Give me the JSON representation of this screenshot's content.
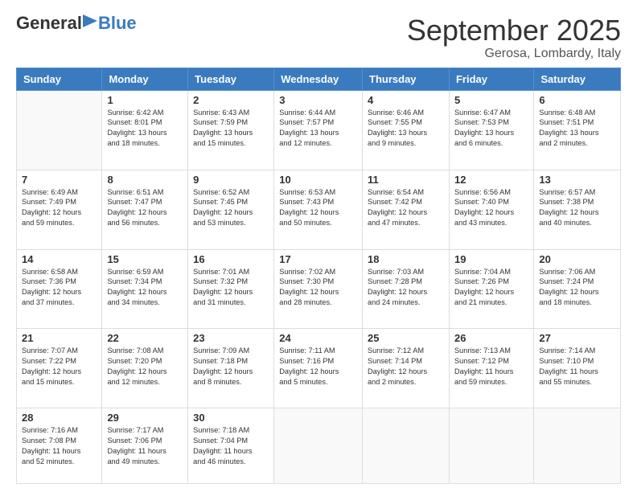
{
  "logo": {
    "general": "General",
    "blue": "Blue"
  },
  "header": {
    "month": "September 2025",
    "location": "Gerosa, Lombardy, Italy"
  },
  "weekdays": [
    "Sunday",
    "Monday",
    "Tuesday",
    "Wednesday",
    "Thursday",
    "Friday",
    "Saturday"
  ],
  "weeks": [
    [
      {
        "day": "",
        "info": ""
      },
      {
        "day": "1",
        "info": "Sunrise: 6:42 AM\nSunset: 8:01 PM\nDaylight: 13 hours\nand 18 minutes."
      },
      {
        "day": "2",
        "info": "Sunrise: 6:43 AM\nSunset: 7:59 PM\nDaylight: 13 hours\nand 15 minutes."
      },
      {
        "day": "3",
        "info": "Sunrise: 6:44 AM\nSunset: 7:57 PM\nDaylight: 13 hours\nand 12 minutes."
      },
      {
        "day": "4",
        "info": "Sunrise: 6:46 AM\nSunset: 7:55 PM\nDaylight: 13 hours\nand 9 minutes."
      },
      {
        "day": "5",
        "info": "Sunrise: 6:47 AM\nSunset: 7:53 PM\nDaylight: 13 hours\nand 6 minutes."
      },
      {
        "day": "6",
        "info": "Sunrise: 6:48 AM\nSunset: 7:51 PM\nDaylight: 13 hours\nand 2 minutes."
      }
    ],
    [
      {
        "day": "7",
        "info": "Sunrise: 6:49 AM\nSunset: 7:49 PM\nDaylight: 12 hours\nand 59 minutes."
      },
      {
        "day": "8",
        "info": "Sunrise: 6:51 AM\nSunset: 7:47 PM\nDaylight: 12 hours\nand 56 minutes."
      },
      {
        "day": "9",
        "info": "Sunrise: 6:52 AM\nSunset: 7:45 PM\nDaylight: 12 hours\nand 53 minutes."
      },
      {
        "day": "10",
        "info": "Sunrise: 6:53 AM\nSunset: 7:43 PM\nDaylight: 12 hours\nand 50 minutes."
      },
      {
        "day": "11",
        "info": "Sunrise: 6:54 AM\nSunset: 7:42 PM\nDaylight: 12 hours\nand 47 minutes."
      },
      {
        "day": "12",
        "info": "Sunrise: 6:56 AM\nSunset: 7:40 PM\nDaylight: 12 hours\nand 43 minutes."
      },
      {
        "day": "13",
        "info": "Sunrise: 6:57 AM\nSunset: 7:38 PM\nDaylight: 12 hours\nand 40 minutes."
      }
    ],
    [
      {
        "day": "14",
        "info": "Sunrise: 6:58 AM\nSunset: 7:36 PM\nDaylight: 12 hours\nand 37 minutes."
      },
      {
        "day": "15",
        "info": "Sunrise: 6:59 AM\nSunset: 7:34 PM\nDaylight: 12 hours\nand 34 minutes."
      },
      {
        "day": "16",
        "info": "Sunrise: 7:01 AM\nSunset: 7:32 PM\nDaylight: 12 hours\nand 31 minutes."
      },
      {
        "day": "17",
        "info": "Sunrise: 7:02 AM\nSunset: 7:30 PM\nDaylight: 12 hours\nand 28 minutes."
      },
      {
        "day": "18",
        "info": "Sunrise: 7:03 AM\nSunset: 7:28 PM\nDaylight: 12 hours\nand 24 minutes."
      },
      {
        "day": "19",
        "info": "Sunrise: 7:04 AM\nSunset: 7:26 PM\nDaylight: 12 hours\nand 21 minutes."
      },
      {
        "day": "20",
        "info": "Sunrise: 7:06 AM\nSunset: 7:24 PM\nDaylight: 12 hours\nand 18 minutes."
      }
    ],
    [
      {
        "day": "21",
        "info": "Sunrise: 7:07 AM\nSunset: 7:22 PM\nDaylight: 12 hours\nand 15 minutes."
      },
      {
        "day": "22",
        "info": "Sunrise: 7:08 AM\nSunset: 7:20 PM\nDaylight: 12 hours\nand 12 minutes."
      },
      {
        "day": "23",
        "info": "Sunrise: 7:09 AM\nSunset: 7:18 PM\nDaylight: 12 hours\nand 8 minutes."
      },
      {
        "day": "24",
        "info": "Sunrise: 7:11 AM\nSunset: 7:16 PM\nDaylight: 12 hours\nand 5 minutes."
      },
      {
        "day": "25",
        "info": "Sunrise: 7:12 AM\nSunset: 7:14 PM\nDaylight: 12 hours\nand 2 minutes."
      },
      {
        "day": "26",
        "info": "Sunrise: 7:13 AM\nSunset: 7:12 PM\nDaylight: 11 hours\nand 59 minutes."
      },
      {
        "day": "27",
        "info": "Sunrise: 7:14 AM\nSunset: 7:10 PM\nDaylight: 11 hours\nand 55 minutes."
      }
    ],
    [
      {
        "day": "28",
        "info": "Sunrise: 7:16 AM\nSunset: 7:08 PM\nDaylight: 11 hours\nand 52 minutes."
      },
      {
        "day": "29",
        "info": "Sunrise: 7:17 AM\nSunset: 7:06 PM\nDaylight: 11 hours\nand 49 minutes."
      },
      {
        "day": "30",
        "info": "Sunrise: 7:18 AM\nSunset: 7:04 PM\nDaylight: 11 hours\nand 46 minutes."
      },
      {
        "day": "",
        "info": ""
      },
      {
        "day": "",
        "info": ""
      },
      {
        "day": "",
        "info": ""
      },
      {
        "day": "",
        "info": ""
      }
    ]
  ]
}
